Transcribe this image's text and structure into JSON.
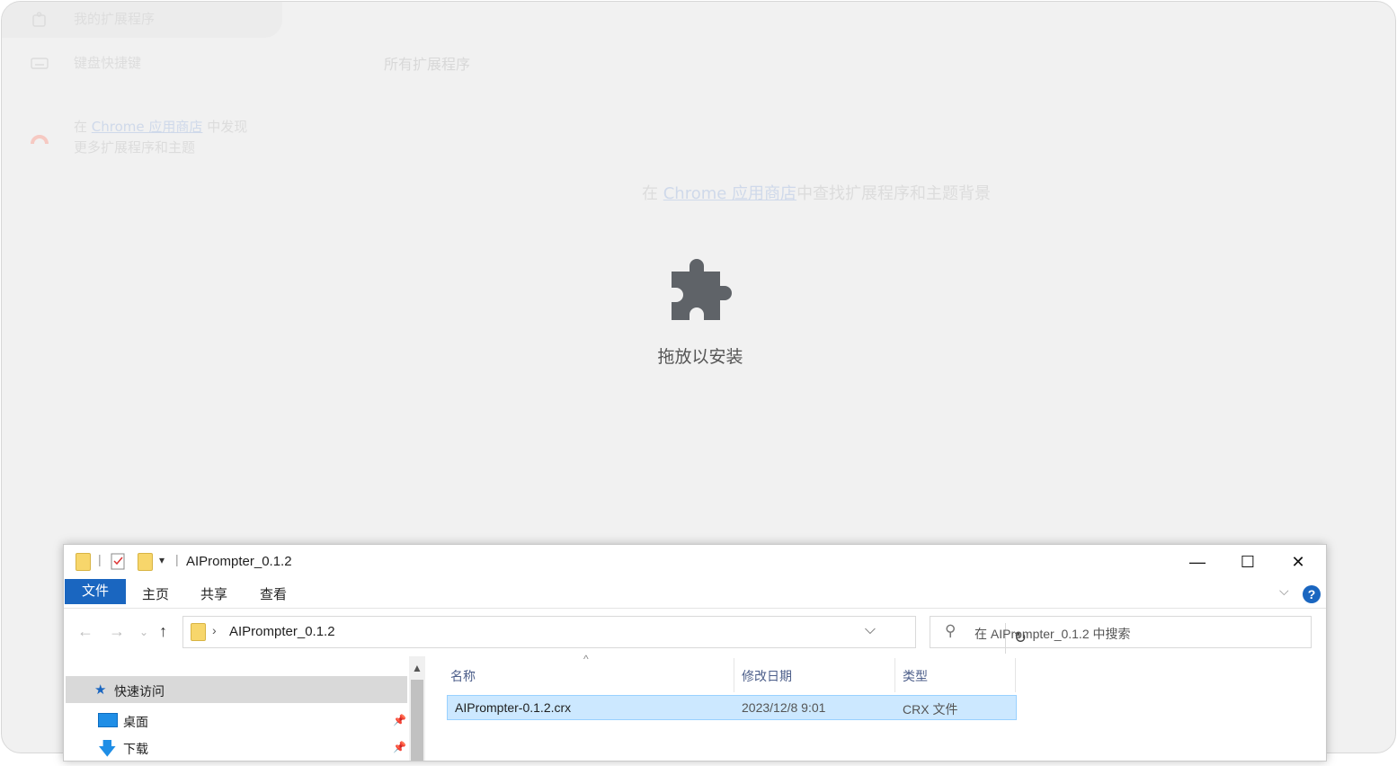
{
  "chrome": {
    "sidebar": {
      "items": [
        {
          "label": "我的扩展程序",
          "icon": "extension-icon"
        },
        {
          "label": "键盘快捷键",
          "icon": "keyboard-icon"
        }
      ],
      "promo": {
        "prefix": "在",
        "link": "Chrome 应用商店",
        "suffix": "中发现",
        "line2": "更多扩展程序和主题",
        "icon": "webstore-icon"
      }
    },
    "section_title": "所有扩展程序",
    "find": {
      "prefix": "在",
      "link": "Chrome 应用商店",
      "suffix": "中查找扩展程序和主题背景"
    },
    "drop_label": "拖放以安装"
  },
  "explorer": {
    "title": "AIPrompter_0.1.2",
    "ribbon_tabs": [
      "文件",
      "主页",
      "共享",
      "查看"
    ],
    "address_path": "AIPrompter_0.1.2",
    "search_placeholder": "在 AIPrompter_0.1.2 中搜索",
    "nav_items": [
      {
        "label": "快速访问",
        "icon": "star-icon"
      },
      {
        "label": "桌面",
        "icon": "desktop-icon"
      },
      {
        "label": "下载",
        "icon": "download-icon"
      }
    ],
    "columns": [
      "名称",
      "修改日期",
      "类型"
    ],
    "files": [
      {
        "name": "AIPrompter-0.1.2.crx",
        "modified": "2023/12/8 9:01",
        "type": "CRX 文件"
      }
    ]
  }
}
